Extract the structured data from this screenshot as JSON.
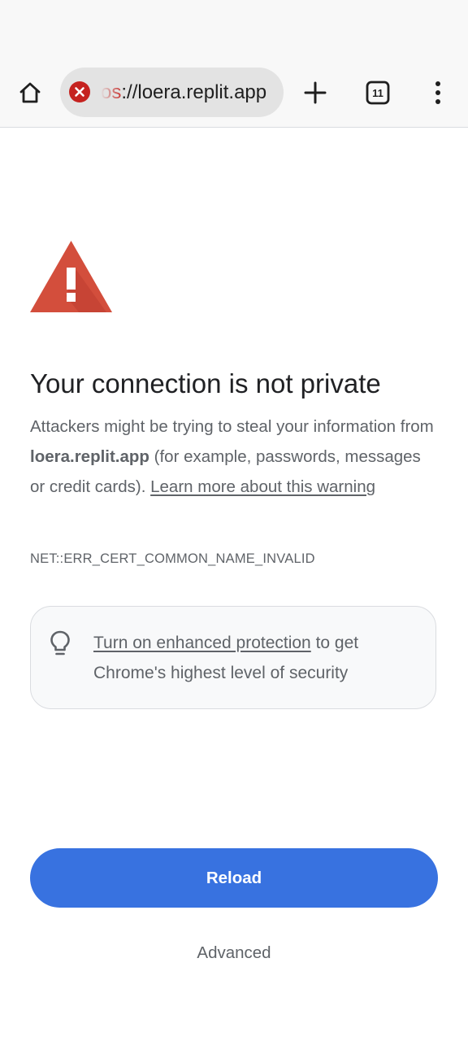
{
  "browser": {
    "url": {
      "scheme_visible": "os",
      "rest": "://loera.replit.app"
    },
    "tab_count": "11",
    "security_state": "not-secure"
  },
  "icons": {
    "home": "home-icon",
    "security": "not-secure-error-icon",
    "new_tab": "plus-icon",
    "tabs": "tab-switcher-icon",
    "menu": "kebab-menu-icon",
    "warning": "warning-triangle-icon",
    "bulb": "lightbulb-icon"
  },
  "interstitial": {
    "title": "Your connection is not private",
    "explanation": {
      "part1": "Attackers might be trying to steal your information from ",
      "domain": "loera.replit.app",
      "part2": " (for example, passwords, messages or credit cards). ",
      "link": "Learn more about this warning"
    },
    "error_code": "NET::ERR_CERT_COMMON_NAME_INVALID",
    "enhanced_protection": {
      "link": "Turn on enhanced protection",
      "text": " to get Chrome's highest level of security"
    },
    "reload_label": "Reload",
    "advanced_label": "Advanced"
  },
  "colors": {
    "accent_blue": "#3872e0",
    "warning_red": "#d34e3c",
    "error_icon_red": "#c5221f",
    "text_secondary": "#5f6368"
  }
}
